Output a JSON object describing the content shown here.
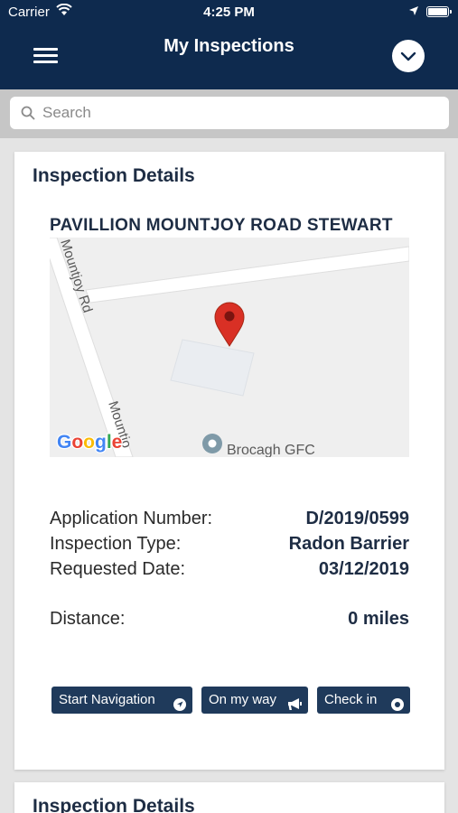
{
  "status_bar": {
    "carrier": "Carrier",
    "time": "4:25 PM"
  },
  "header": {
    "title": "My Inspections"
  },
  "search": {
    "placeholder": "Search"
  },
  "cards": [
    {
      "title": "Inspection Details",
      "address": "PAVILLION MOUNTJOY ROAD STEWART",
      "map": {
        "road_label_top": "Mountjoy Rd",
        "road_label_bottom": "Mountjo",
        "poi": "Brocagh GFC",
        "logo": "Google"
      },
      "fields": [
        {
          "label": "Application Number:",
          "value": "D/2019/0599"
        },
        {
          "label": "Inspection Type:",
          "value": "Radon Barrier"
        },
        {
          "label": "Requested Date:",
          "value": "03/12/2019"
        },
        {
          "label": "Distance:",
          "value": "0 miles"
        }
      ],
      "buttons": {
        "start_navigation": "Start Navigation",
        "on_my_way": "On my way",
        "check_in": "Check in"
      }
    },
    {
      "title": "Inspection Details"
    }
  ],
  "colors": {
    "header": "#0e2a4e",
    "button": "#1f3a5b",
    "marker": "#d93025",
    "text_dark": "#1e2d44"
  }
}
